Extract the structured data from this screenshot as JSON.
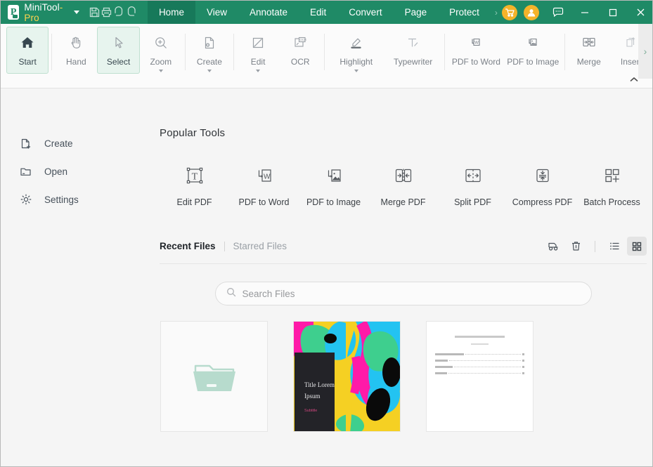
{
  "titlebar": {
    "brand_logo_text": "P",
    "brand_name_main": "MiniTool",
    "brand_name_suffix": "-Pro",
    "quick_icons": [
      {
        "name": "save-icon",
        "label": "Save"
      },
      {
        "name": "print-icon",
        "label": "Print"
      },
      {
        "name": "undo-icon",
        "label": "Undo"
      },
      {
        "name": "redo-icon",
        "label": "Redo"
      }
    ],
    "tabs": [
      {
        "label": "Home",
        "active": true
      },
      {
        "label": "View",
        "active": false
      },
      {
        "label": "Annotate",
        "active": false
      },
      {
        "label": "Edit",
        "active": false
      },
      {
        "label": "Convert",
        "active": false
      },
      {
        "label": "Page",
        "active": false
      },
      {
        "label": "Protect",
        "active": false
      }
    ],
    "tab_overflow": "›",
    "cart_label": "Buy",
    "account_label": "Account",
    "feedback_label": "Feedback",
    "minimize_label": "─",
    "maximize_label": "□",
    "close_label": "✕",
    "accent_color": "#1f8a66",
    "accent_active_color": "#17795a",
    "badge_color": "#f5b32a"
  },
  "ribbon": {
    "items": [
      {
        "label": "Start",
        "icon": "home-icon",
        "active": true,
        "caret": false
      },
      {
        "label": "Hand",
        "icon": "hand-icon",
        "active": false,
        "caret": false
      },
      {
        "label": "Select",
        "icon": "cursor-icon",
        "active": true,
        "caret": false
      },
      {
        "label": "Zoom",
        "icon": "zoom-in-icon",
        "active": false,
        "caret": true
      },
      {
        "label": "Create",
        "icon": "create-file-icon",
        "active": false,
        "caret": true
      },
      {
        "label": "Edit",
        "icon": "edit-pencil-icon",
        "active": false,
        "caret": true
      },
      {
        "label": "OCR",
        "icon": "ocr-icon",
        "active": false,
        "caret": false
      },
      {
        "label": "Highlight",
        "icon": "highlighter-icon",
        "active": false,
        "caret": true
      },
      {
        "label": "Typewriter",
        "icon": "typewriter-icon",
        "active": false,
        "caret": false
      },
      {
        "label": "PDF to Word",
        "icon": "pdf-to-word-icon",
        "active": false,
        "caret": false
      },
      {
        "label": "PDF to Image",
        "icon": "pdf-to-image-icon",
        "active": false,
        "caret": false
      },
      {
        "label": "Merge",
        "icon": "merge-icon",
        "active": false,
        "caret": false
      },
      {
        "label": "Insert",
        "icon": "insert-page-icon",
        "active": false,
        "caret": false
      }
    ],
    "scroll_right": "›",
    "collapse": "˄"
  },
  "sidebar": {
    "items": [
      {
        "label": "Create",
        "icon": "create-file-icon"
      },
      {
        "label": "Open",
        "icon": "folder-open-icon"
      },
      {
        "label": "Settings",
        "icon": "gear-icon"
      }
    ]
  },
  "main": {
    "section_title": "Popular Tools",
    "tools": [
      {
        "label": "Edit PDF",
        "icon": "text-box-icon"
      },
      {
        "label": "PDF to Word",
        "icon": "pdf-to-word-icon"
      },
      {
        "label": "PDF to Image",
        "icon": "pdf-to-image-icon"
      },
      {
        "label": "Merge PDF",
        "icon": "merge-icon"
      },
      {
        "label": "Split PDF",
        "icon": "split-icon"
      },
      {
        "label": "Compress PDF",
        "icon": "compress-icon"
      },
      {
        "label": "Batch Process",
        "icon": "batch-grid-icon"
      }
    ],
    "recent": {
      "tab_recent": "Recent Files",
      "tab_starred": "Starred Files",
      "actions": [
        {
          "name": "clear-recent-icon",
          "label": "Clear Recent"
        },
        {
          "name": "delete-icon",
          "label": "Delete"
        },
        {
          "name": "list-view-icon",
          "label": "List View"
        },
        {
          "name": "grid-view-icon",
          "label": "Grid View",
          "selected": true
        }
      ]
    },
    "search": {
      "placeholder": "Search Files",
      "value": "",
      "icon": "search-icon"
    },
    "thumbnails": [
      {
        "name": "open-file-placeholder",
        "type": "empty",
        "icon": "folder-icon"
      },
      {
        "name": "file-thumbnail-cover",
        "type": "cover",
        "title_line1": "Title Lorem",
        "title_line2": "Ipsum",
        "subtitle": "Subtitle"
      },
      {
        "name": "file-thumbnail-document",
        "type": "document"
      }
    ]
  }
}
